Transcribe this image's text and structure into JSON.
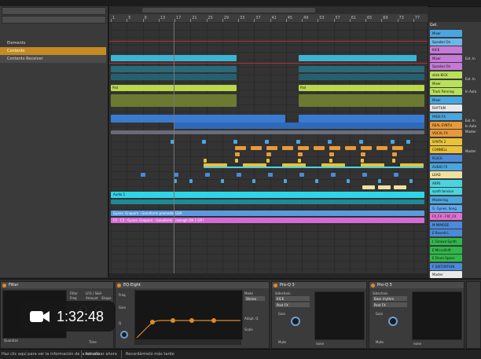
{
  "browser": {
    "items": [
      {
        "label": "Elements",
        "state": "normal"
      },
      {
        "label": "Contents",
        "state": "selected"
      },
      {
        "label": "Contents Receiver",
        "state": "highlight"
      }
    ]
  },
  "ruler": {
    "bars": [
      "1",
      "5",
      "9",
      "13",
      "17",
      "21",
      "25",
      "29",
      "33",
      "37",
      "41",
      "45",
      "49",
      "53",
      "57",
      "61",
      "65",
      "69",
      "73",
      "77"
    ]
  },
  "clips": {
    "audio_clip_label": "Audio 1",
    "pad_clip_label": "Pad",
    "long_clip_1": "Gynes. Gnaporn - Gonaformi promedio GDA",
    "long_clip_2": "F2 - C3 - Gynes. Gnaporn - Gonaformi Cramagh DH 1 GP I"
  },
  "mixer": {
    "top_label": "Gel.",
    "tracks": [
      {
        "name": "Mixer",
        "color": "#4aa6e0"
      },
      {
        "name": "Speaker On",
        "color": "#6fb6e8"
      },
      {
        "name": "KICK",
        "color": "#c47ad6"
      },
      {
        "name": "Mixer",
        "color": "#c47ad6"
      },
      {
        "name": "Speaker On",
        "color": "#c47ad6"
      },
      {
        "name": "stick KICK",
        "color": "#b9e05a"
      },
      {
        "name": "Mixer",
        "color": "#b9e05a"
      },
      {
        "name": "Track Panning",
        "color": "#b9e05a"
      },
      {
        "name": "Mixer",
        "color": "#4aa6e0"
      },
      {
        "name": "RHYTHM",
        "color": "#e8e8e8"
      },
      {
        "name": "PADS FX",
        "color": "#4aa6e0"
      },
      {
        "name": "REAL SYNTH",
        "color": "#e89a3a"
      },
      {
        "name": "VOCAL FX",
        "color": "#e89a3a"
      },
      {
        "name": "SYNTH 2",
        "color": "#e8c23a"
      },
      {
        "name": "CONNELL",
        "color": "#e8c23a"
      },
      {
        "name": "PLUCK",
        "color": "#4a8ad8"
      },
      {
        "name": "AUDIO FX",
        "color": "#4aa6e0"
      },
      {
        "name": "LEAD",
        "color": "#f0e0a0"
      },
      {
        "name": "ARPS",
        "color": "#4ad4e0"
      },
      {
        "name": "synth tension",
        "color": "#4ad4e0"
      },
      {
        "name": "Mastering",
        "color": "#4aa6e0"
      },
      {
        "name": "G. Gynes. Song",
        "color": "#5fa8f0"
      },
      {
        "name": "FX_FX - FXF_FX",
        "color": "#e070d0"
      },
      {
        "name": "M MIMOSE",
        "color": "#4a8ad8"
      },
      {
        "name": "E Reverb L",
        "color": "#4a8ad8"
      },
      {
        "name": "I. Groove Synth",
        "color": "#2fb84a"
      },
      {
        "name": "E MicroShift",
        "color": "#2fb84a"
      },
      {
        "name": "E Drum Space",
        "color": "#2fb84a"
      },
      {
        "name": "F DISTORTION",
        "color": "#4a8ad8"
      },
      {
        "name": "Master",
        "color": "#e8e8e8"
      }
    ],
    "side_labels": [
      "Ext. In",
      "Master",
      "Ext. In",
      "In Auto",
      "Ext. In",
      "In Auto",
      "Master"
    ]
  },
  "devices": {
    "d1": {
      "title": "Filter",
      "labels": [
        "Filter",
        "Freq",
        "LFO / S&H",
        "Amount",
        "Shape",
        "Sync",
        "Quantize",
        "Time"
      ]
    },
    "d2": {
      "title": "EQ-Eight",
      "labels": [
        "Freq",
        "Gain",
        "Q",
        "Mode",
        "Stereo",
        "Adapt. Q",
        "Scale"
      ]
    },
    "d3": {
      "title": "Pro-Q 3",
      "labels": [
        "Sidechain",
        "KICK",
        "Post FX",
        "Gain",
        "Mute",
        "none"
      ]
    },
    "d4": {
      "title": "Pro-Q 3",
      "labels": [
        "Sidechain",
        "Bass rhythm",
        "Post FX",
        "Gain",
        "Mute",
        "none"
      ]
    }
  },
  "status": {
    "left": "Haz clic aquí para ver la información de la versión",
    "mid": "Actualizar ahora",
    "right": "Recordármelo más tarde"
  },
  "video": {
    "duration": "1:32:48",
    "icon": "camera-icon"
  }
}
